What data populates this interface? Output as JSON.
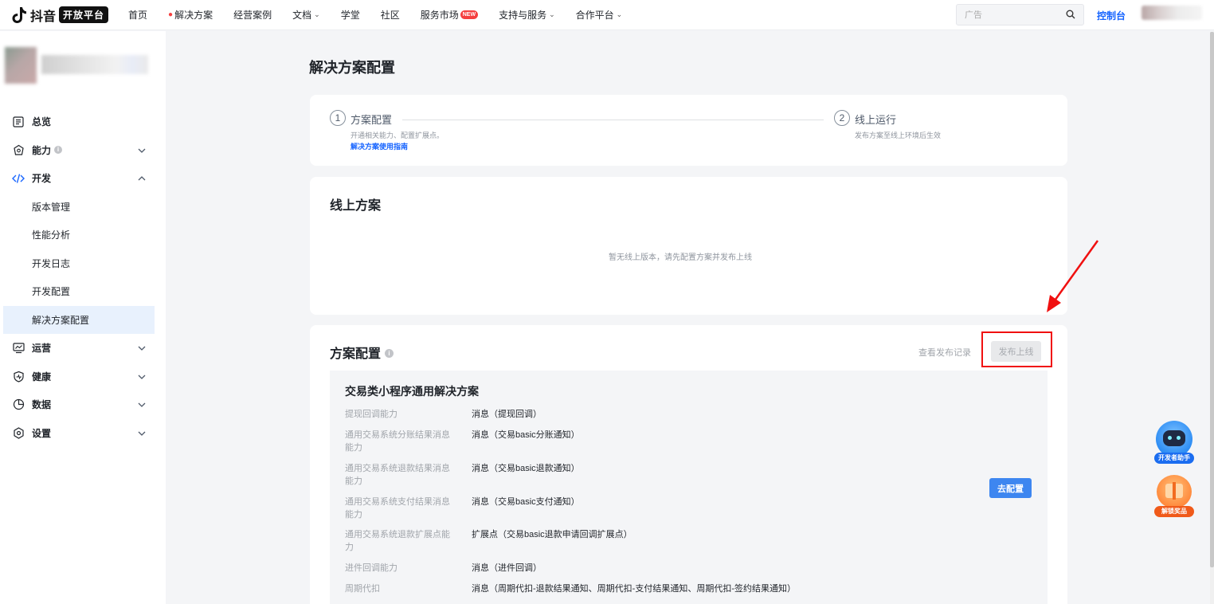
{
  "nav": {
    "logo_text": "抖音",
    "logo_badge": "开放平台",
    "items": [
      {
        "label": "首页"
      },
      {
        "label": "解决方案"
      },
      {
        "label": "经营案例"
      },
      {
        "label": "文档"
      },
      {
        "label": "学堂"
      },
      {
        "label": "社区"
      },
      {
        "label": "服务市场",
        "badge": "NEW"
      },
      {
        "label": "支持与服务"
      },
      {
        "label": "合作平台"
      }
    ],
    "search_placeholder": "广告",
    "console": "控制台"
  },
  "sidebar": {
    "items": [
      {
        "label": "总览",
        "icon": "overview-icon"
      },
      {
        "label": "能力",
        "icon": "capability-icon",
        "info": "i"
      },
      {
        "label": "开发",
        "icon": "code-icon"
      },
      {
        "label": "运营",
        "icon": "operation-icon"
      },
      {
        "label": "健康",
        "icon": "health-icon"
      },
      {
        "label": "数据",
        "icon": "data-icon"
      },
      {
        "label": "设置",
        "icon": "settings-icon"
      }
    ],
    "dev_sub": [
      {
        "label": "版本管理"
      },
      {
        "label": "性能分析"
      },
      {
        "label": "开发日志"
      },
      {
        "label": "开发配置"
      },
      {
        "label": "解决方案配置",
        "active": true
      }
    ]
  },
  "page": {
    "title": "解决方案配置"
  },
  "steps": {
    "step1": {
      "num": "1",
      "title": "方案配置",
      "desc": "开通相关能力、配置扩展点。",
      "link": "解决方案使用指南"
    },
    "step2": {
      "num": "2",
      "title": "线上运行",
      "desc": "发布方案至线上环境后生效"
    }
  },
  "online": {
    "title": "线上方案",
    "empty": "暂无线上版本，请先配置方案并发布上线"
  },
  "config": {
    "title": "方案配置",
    "info": "i",
    "view_records": "查看发布记录",
    "publish": "发布上线",
    "solution_title": "交易类小程序通用解决方案",
    "go_config": "去配置",
    "capabilities": [
      {
        "label": "提现回调能力",
        "value": "消息（提现回调）"
      },
      {
        "label": "通用交易系统分账结果消息能力",
        "value": "消息（交易basic分账通知）"
      },
      {
        "label": "通用交易系统退款结果消息能力",
        "value": "消息（交易basic退款通知）"
      },
      {
        "label": "通用交易系统支付结果消息能力",
        "value": "消息（交易basic支付通知）"
      },
      {
        "label": "通用交易系统退款扩展点能力",
        "value": "扩展点（交易basic退款申请回调扩展点）"
      },
      {
        "label": "进件回调能力",
        "value": "消息（进件回调）"
      },
      {
        "label": "周期代扣",
        "value": "消息（周期代扣-退款结果通知、周期代扣-支付结果通知、周期代扣-签约结果通知）"
      }
    ]
  },
  "widgets": {
    "assistant": "开发者助手",
    "reward": "解锁奖品"
  },
  "colors": {
    "primary": "#1664ff",
    "button": "#3d86f0",
    "annotation": "#f01010",
    "active_bg": "#e8f1fd"
  }
}
